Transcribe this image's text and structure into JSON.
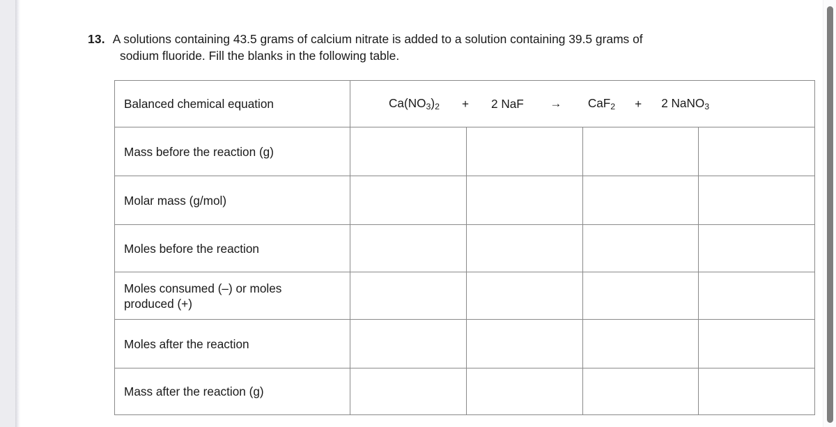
{
  "document": {
    "question_number": "13.",
    "question_text_line1": "A solutions containing 43.5 grams of calcium nitrate is added to a solution containing 39.5 grams of",
    "question_text_line2": "sodium fluoride.  Fill the blanks in the following table."
  },
  "equation": {
    "reactant_1": "Ca(NO3)2",
    "reactant_1_parts": {
      "pre": "Ca(NO",
      "sub1": "3",
      "mid": ")",
      "sub2": "2"
    },
    "operator_1": "+",
    "reactant_2": "2 NaF",
    "arrow": "→",
    "product_1": "CaF2",
    "product_1_parts": {
      "pre": "CaF",
      "sub1": "2"
    },
    "operator_2": "+",
    "product_2": "2 NaNO3",
    "product_2_parts": {
      "pre": "2 NaNO",
      "sub1": "3"
    }
  },
  "table": {
    "rows": [
      {
        "label": "Balanced chemical equation",
        "cells": [
          "",
          "",
          "",
          ""
        ]
      },
      {
        "label": "Mass before the reaction (g)",
        "cells": [
          "",
          "",
          "",
          ""
        ]
      },
      {
        "label": "Molar mass (g/mol)",
        "cells": [
          "",
          "",
          "",
          ""
        ]
      },
      {
        "label": "Moles before the reaction",
        "cells": [
          "",
          "",
          "",
          ""
        ]
      },
      {
        "label": "Moles consumed (–) or moles produced (+)",
        "label_line1": "Moles consumed (–) or moles",
        "label_line2": "produced (+)",
        "cells": [
          "",
          "",
          "",
          ""
        ]
      },
      {
        "label": "Moles after the reaction",
        "cells": [
          "",
          "",
          "",
          ""
        ]
      },
      {
        "label": "Mass after the reaction (g)",
        "cells": [
          "",
          "",
          "",
          ""
        ]
      }
    ]
  },
  "colors": {
    "page_background": "#ffffff",
    "gutter_background": "#ececf0",
    "table_border": "#8a8a8a",
    "text": "#1a1a1a",
    "scrollbar_thumb": "#7e7e7e",
    "scrollbar_track": "#fbfbfc"
  }
}
